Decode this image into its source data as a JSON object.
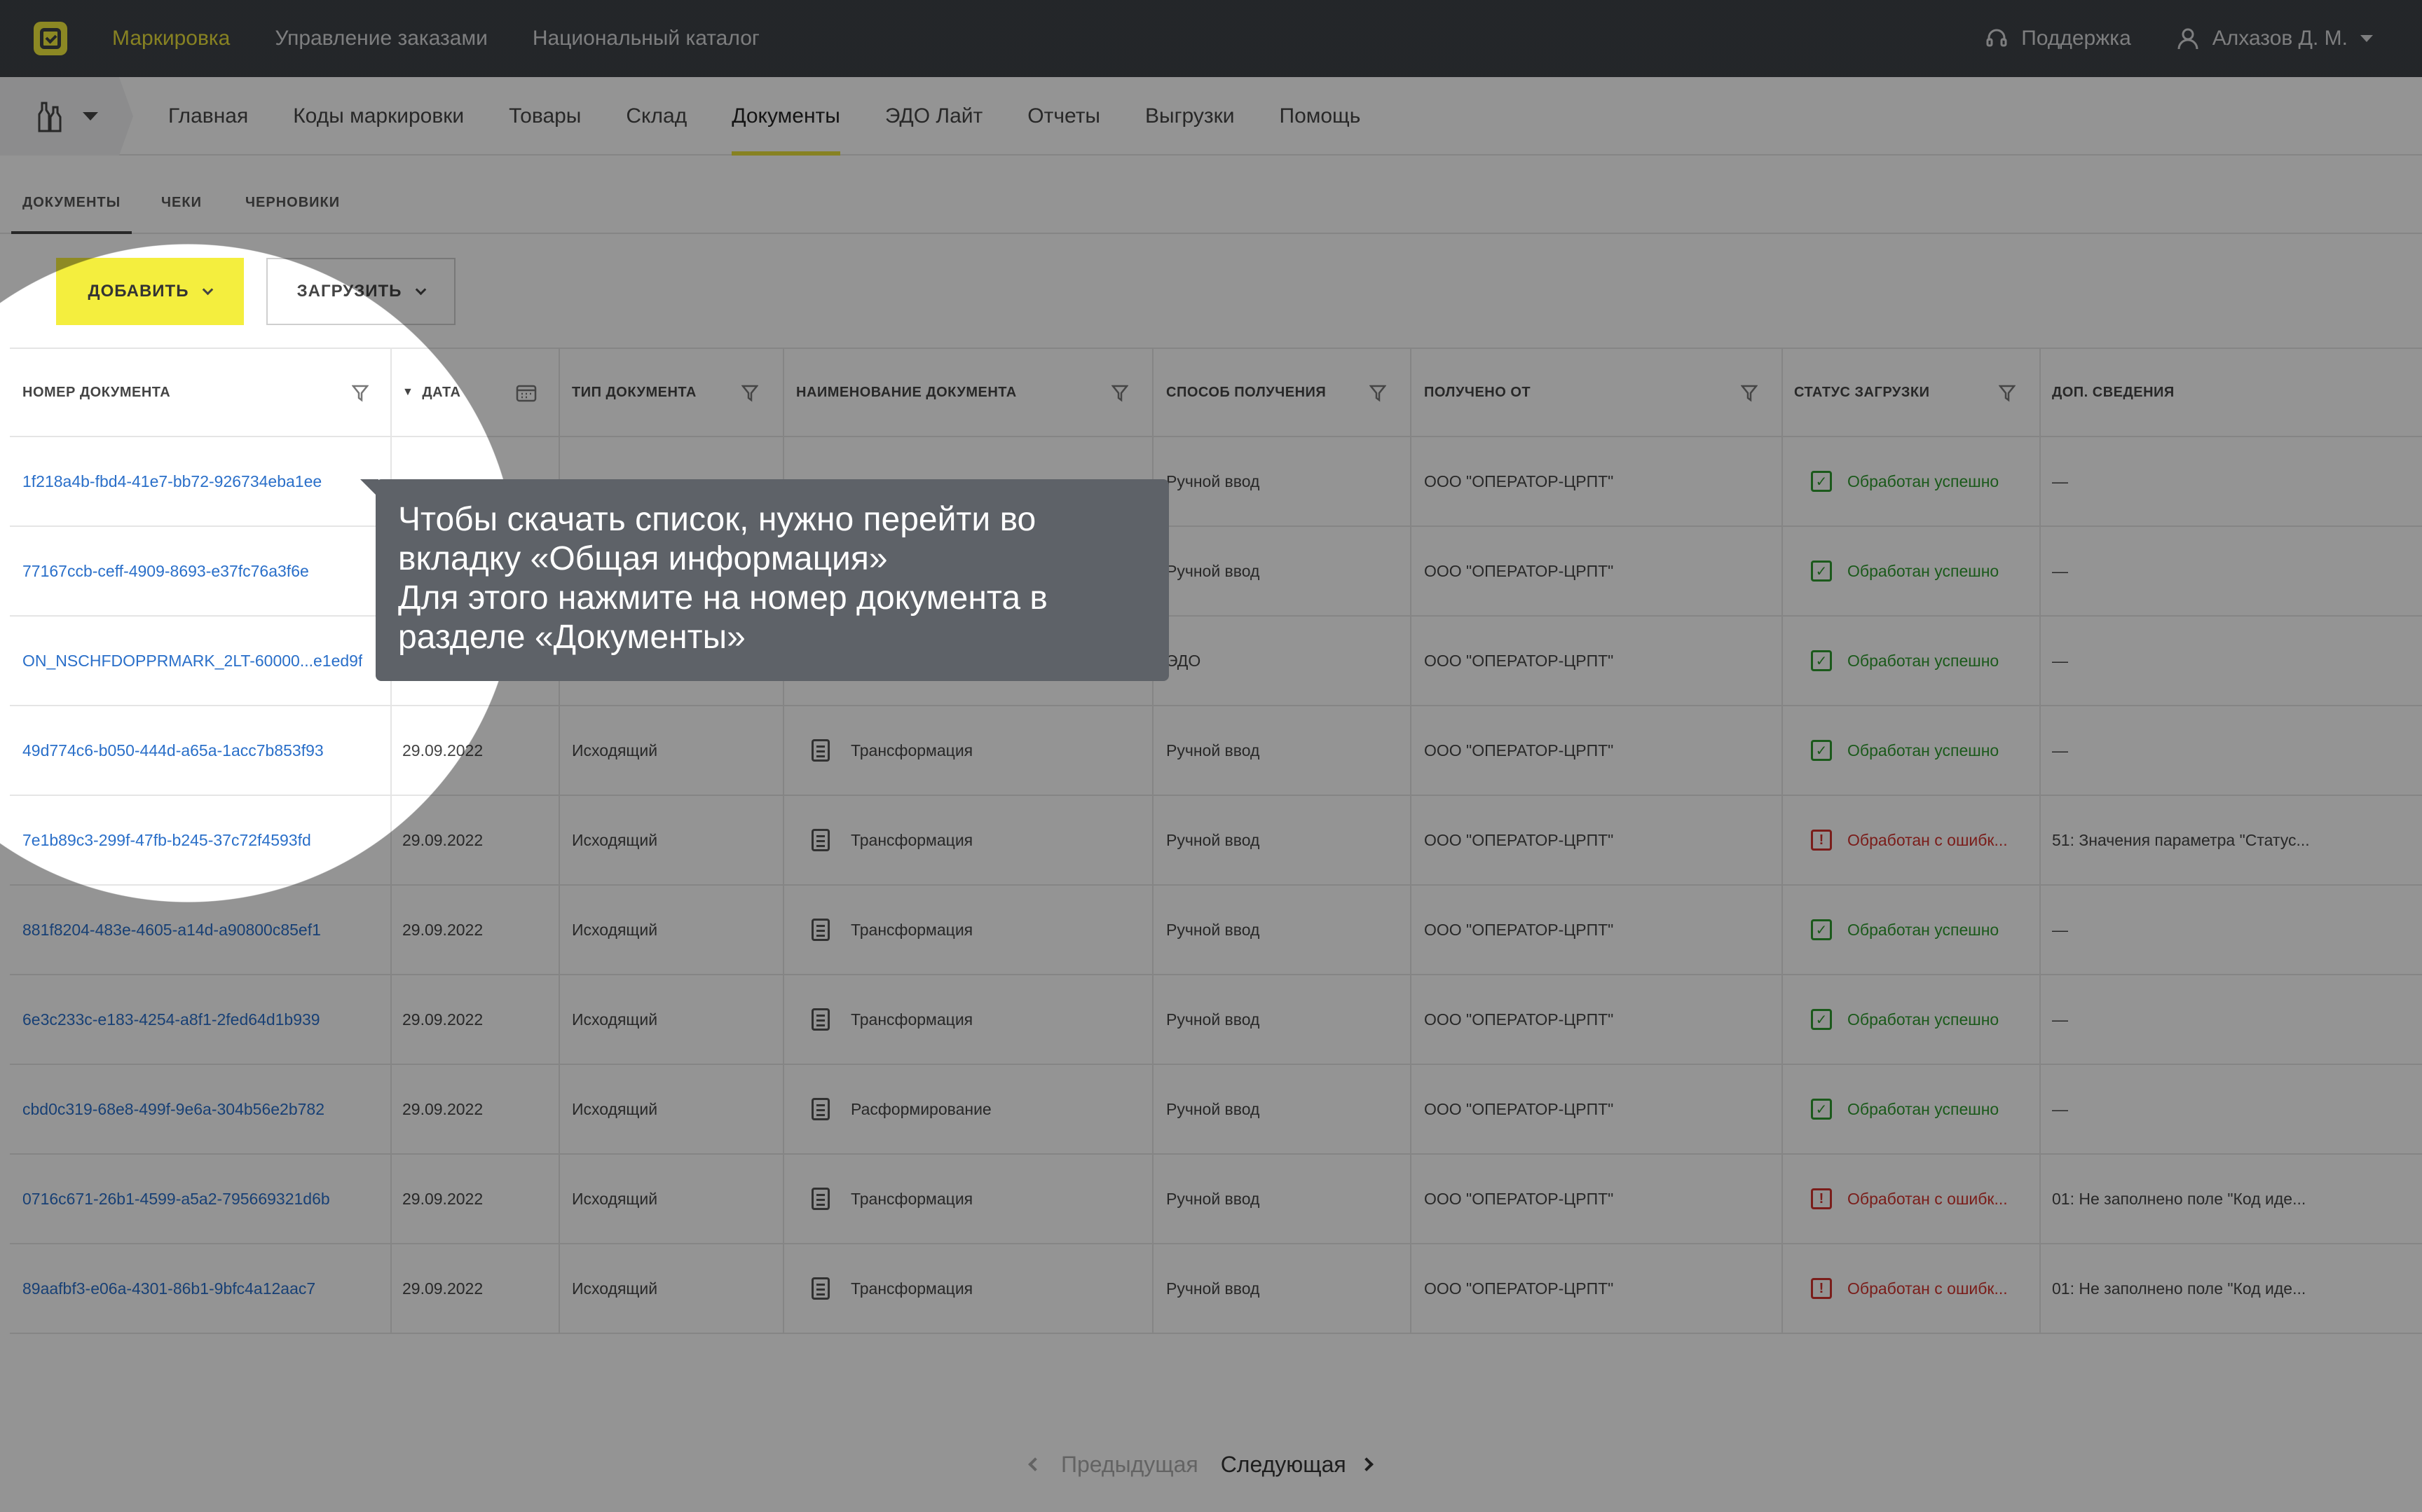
{
  "topbar": {
    "nav": [
      "Маркировка",
      "Управление заказами",
      "Национальный каталог"
    ],
    "active": 0,
    "support": "Поддержка",
    "user": "Алхазов Д. М."
  },
  "subnav": [
    "Главная",
    "Коды маркировки",
    "Товары",
    "Склад",
    "Документы",
    "ЭДО Лайт",
    "Отчеты",
    "Выгрузки",
    "Помощь"
  ],
  "subnav_active": 4,
  "tabs": [
    "ДОКУМЕНТЫ",
    "ЧЕКИ",
    "ЧЕРНОВИКИ"
  ],
  "buttons": {
    "add": "ДОБАВИТЬ",
    "load": "ЗАГРУЗИТЬ"
  },
  "columns": [
    "НОМЕР ДОКУМЕНТА",
    "ДАТА",
    "ТИП ДОКУМЕНТА",
    "НАИМЕНОВАНИЕ ДОКУМЕНТА",
    "СПОСОБ ПОЛУЧЕНИЯ",
    "ПОЛУЧЕНО ОТ",
    "СТАТУС ЗАГРУЗКИ",
    "ДОП. СВЕДЕНИЯ"
  ],
  "rows": [
    {
      "number": "1f218a4b-fbd4-41e7-bb72-926734eba1ee",
      "date": "",
      "type": "",
      "name": "",
      "method": "Ручной ввод",
      "from": "ООО \"ОПЕРАТОР-ЦРПТ\"",
      "status": "Обработан успешно",
      "status_kind": "ok",
      "info": "—"
    },
    {
      "number": "77167ccb-ceff-4909-8693-e37fc76a3f6e",
      "date": "",
      "type": "",
      "name": "",
      "method": "Ручной ввод",
      "from": "ООО \"ОПЕРАТОР-ЦРПТ\"",
      "status": "Обработан успешно",
      "status_kind": "ok",
      "info": "—"
    },
    {
      "number": "ON_NSCHFDOPPRMARK_2LT-60000...e1ed9f",
      "date": "",
      "type": "",
      "name": "",
      "method": "ЭДО",
      "from": "ООО \"ОПЕРАТОР-ЦРПТ\"",
      "status": "Обработан успешно",
      "status_kind": "ok",
      "info": "—"
    },
    {
      "number": "49d774c6-b050-444d-a65a-1acc7b853f93",
      "date": "29.09.2022",
      "type": "Исходящий",
      "name": "Трансформация",
      "method": "Ручной ввод",
      "from": "ООО \"ОПЕРАТОР-ЦРПТ\"",
      "status": "Обработан успешно",
      "status_kind": "ok",
      "info": "—"
    },
    {
      "number": "7e1b89c3-299f-47fb-b245-37c72f4593fd",
      "date": "29.09.2022",
      "type": "Исходящий",
      "name": "Трансформация",
      "method": "Ручной ввод",
      "from": "ООО \"ОПЕРАТОР-ЦРПТ\"",
      "status": "Обработан с ошибк...",
      "status_kind": "err",
      "info": "51: Значения параметра \"Статус..."
    },
    {
      "number": "881f8204-483e-4605-a14d-a90800c85ef1",
      "date": "29.09.2022",
      "type": "Исходящий",
      "name": "Трансформация",
      "method": "Ручной ввод",
      "from": "ООО \"ОПЕРАТОР-ЦРПТ\"",
      "status": "Обработан успешно",
      "status_kind": "ok",
      "info": "—"
    },
    {
      "number": "6e3c233c-e183-4254-a8f1-2fed64d1b939",
      "date": "29.09.2022",
      "type": "Исходящий",
      "name": "Трансформация",
      "method": "Ручной ввод",
      "from": "ООО \"ОПЕРАТОР-ЦРПТ\"",
      "status": "Обработан успешно",
      "status_kind": "ok",
      "info": "—"
    },
    {
      "number": "cbd0c319-68e8-499f-9e6a-304b56e2b782",
      "date": "29.09.2022",
      "type": "Исходящий",
      "name": "Расформирование",
      "method": "Ручной ввод",
      "from": "ООО \"ОПЕРАТОР-ЦРПТ\"",
      "status": "Обработан успешно",
      "status_kind": "ok",
      "info": "—"
    },
    {
      "number": "0716c671-26b1-4599-a5a2-795669321d6b",
      "date": "29.09.2022",
      "type": "Исходящий",
      "name": "Трансформация",
      "method": "Ручной ввод",
      "from": "ООО \"ОПЕРАТОР-ЦРПТ\"",
      "status": "Обработан с ошибк...",
      "status_kind": "err",
      "info": "01: Не заполнено поле \"Код иде..."
    },
    {
      "number": "89aafbf3-e06a-4301-86b1-9bfc4a12aac7",
      "date": "29.09.2022",
      "type": "Исходящий",
      "name": "Трансформация",
      "method": "Ручной ввод",
      "from": "ООО \"ОПЕРАТОР-ЦРПТ\"",
      "status": "Обработан с ошибк...",
      "status_kind": "err",
      "info": "01: Не заполнено поле \"Код иде..."
    }
  ],
  "pager": {
    "prev": "Предыдущая",
    "next": "Следующая"
  },
  "tooltip": {
    "lines": [
      "Чтобы скачать список, нужно перейти во",
      "вкладку «Общая информация»",
      "Для этого нажмите на номер документа в",
      "разделе «Документы»"
    ]
  },
  "colors": {
    "accent": "#f4ee3e",
    "topbar": "#3d4147",
    "link": "#2a6fc9",
    "ok": "#2e9a2e",
    "error": "#d2322d"
  },
  "icons": {
    "logo": "check-square-icon",
    "support": "headset-icon",
    "user": "user-icon",
    "org": "bottles-icon",
    "filter": "filter-icon",
    "calendar": "calendar-icon",
    "document": "document-icon"
  }
}
